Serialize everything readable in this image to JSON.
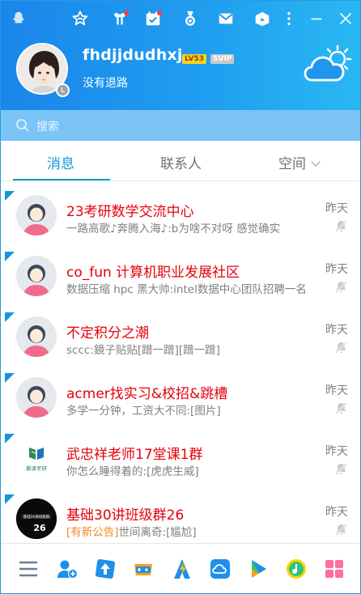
{
  "header": {
    "username": "fhdjjdudhxj",
    "level_badge": "LV53",
    "vip_badge": "SVIP",
    "signature": "没有退路",
    "titlebar_icons": [
      "qq-logo-icon",
      "star-icon",
      "gift-icon",
      "calendar-check-icon",
      "medal-icon",
      "mail-icon",
      "box-icon",
      "more-icon",
      "minimize-icon",
      "close-icon"
    ]
  },
  "search": {
    "placeholder": "搜索"
  },
  "tabs": [
    {
      "label": "消息"
    },
    {
      "label": "联系人"
    },
    {
      "label": "空间"
    }
  ],
  "conversations": [
    {
      "name": "23考研数学交流中心",
      "message": "一路高歌♪奔腾入海♪:b为啥不对呀 感觉确实",
      "time": "昨天",
      "avatar": "default-group"
    },
    {
      "name": "co_fun 计算机职业发展社区",
      "message": "数据压缩 hpc 黑大帅:intel数据中心团队招聘一名",
      "time": "昨天",
      "avatar": "default-group"
    },
    {
      "name": "不定积分之潮",
      "message": "sccc:鏡子贴贴[蹭一蹭][蹭一蹭]",
      "time": "昨天",
      "avatar": "default-group"
    },
    {
      "name": "acmer找实习&校招&跳槽",
      "message": "多学一分钟，工资大不同:[图片]",
      "time": "昨天",
      "avatar": "default-group"
    },
    {
      "name": "武忠祥老师17堂课1群",
      "message": "你怎么睡得着的:[虎虎生威]",
      "time": "昨天",
      "avatar": "book-logo"
    },
    {
      "name": "基础30讲班级群26",
      "notice": "[有新公告]",
      "message": "世间离奇:[尴尬]",
      "time": "昨天",
      "avatar": "dark-26"
    }
  ],
  "book_logo_text": "慕课考研",
  "dark_avatar_text": "26",
  "dark_avatar_sub": "基础30讲班级群",
  "bottom_icons": [
    "menu-icon",
    "add-friend-icon",
    "upload-icon",
    "game-icon",
    "lightning-icon",
    "cloud-drive-icon",
    "video-icon",
    "music-icon",
    "apps-icon"
  ],
  "colors": {
    "header_start": "#1a86ea",
    "header_end": "#29b8f3",
    "accent": "#1296db",
    "unread_name": "#e5000b",
    "notice": "#f08a24"
  }
}
